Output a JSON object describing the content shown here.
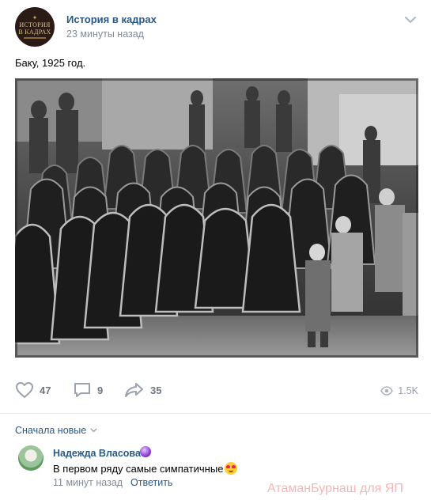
{
  "post": {
    "group_name": "История в кадрах",
    "time": "23 минуты назад",
    "text": "Баку, 1925 год.",
    "avatar_logo_line1": "ИСТОРИЯ",
    "avatar_logo_line2": "В КАДРАХ"
  },
  "actions": {
    "likes": "47",
    "comments": "9",
    "shares": "35",
    "views": "1.5K"
  },
  "comments_section": {
    "sort_label": "Сначала новые",
    "items": [
      {
        "author": "Надежда Власова",
        "text": "В первом ряду самые симпатичные",
        "time": "11 минут назад",
        "reply_label": "Ответить"
      }
    ]
  },
  "watermark": "АтаманБурнаш для ЯП",
  "icons": {
    "menu": "chevron-down-icon",
    "like": "heart-icon",
    "comment": "speech-bubble-icon",
    "share": "share-arrow-icon",
    "views": "eye-icon"
  },
  "colors": {
    "link": "#2a5885",
    "muted": "#818c99",
    "icon": "#99a2ad"
  }
}
